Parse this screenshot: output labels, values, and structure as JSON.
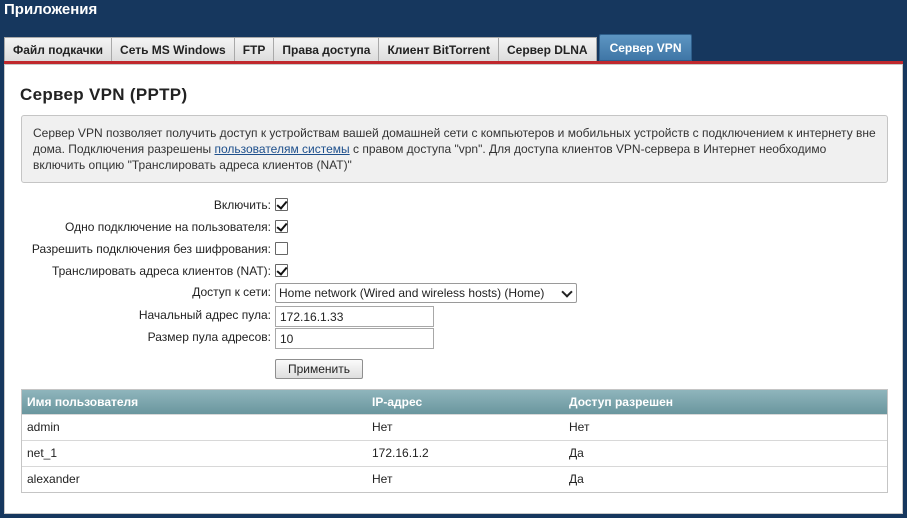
{
  "app": {
    "title": "Приложения"
  },
  "tabs": [
    {
      "label": "Файл подкачки",
      "active": false
    },
    {
      "label": "Сеть MS Windows",
      "active": false
    },
    {
      "label": "FTP",
      "active": false
    },
    {
      "label": "Права доступа",
      "active": false
    },
    {
      "label": "Клиент BitTorrent",
      "active": false
    },
    {
      "label": "Сервер DLNA",
      "active": false
    },
    {
      "label": "Сервер VPN",
      "active": true
    }
  ],
  "page": {
    "title": "Сервер VPN (PPTP)"
  },
  "info": {
    "text_before": "Сервер VPN позволяет получить доступ к устройствам вашей домашней сети с компьютеров и мобильных устройств с подключением к интернету вне дома. Подключения разрешены ",
    "link": "пользователям системы",
    "text_after": " с правом доступа \"vpn\". Для доступа клиентов VPN-сервера в Интернет необходимо включить опцию \"Транслировать адреса клиентов (NAT)\""
  },
  "form": {
    "enable_label": "Включить:",
    "enable_checked": true,
    "single_conn_label": "Одно подключение на пользователя:",
    "single_conn_checked": true,
    "no_encryption_label": "Разрешить подключения без шифрования:",
    "no_encryption_checked": false,
    "nat_label": "Транслировать адреса клиентов (NAT):",
    "nat_checked": true,
    "network_label": "Доступ к сети:",
    "network_value": "Home network (Wired and wireless hosts) (Home)",
    "pool_start_label": "Начальный адрес пула:",
    "pool_start_value": "172.16.1.33",
    "pool_size_label": "Размер пула адресов:",
    "pool_size_value": "10",
    "apply_label": "Применить"
  },
  "users_table": {
    "headers": [
      "Имя пользователя",
      "IP-адрес",
      "Доступ разрешен"
    ],
    "rows": [
      [
        "admin",
        "Нет",
        "Нет"
      ],
      [
        "net_1",
        "172.16.1.2",
        "Да"
      ],
      [
        "alexander",
        "Нет",
        "Да"
      ]
    ]
  },
  "colors": {
    "header_bg": "#16375e",
    "active_tab": "#4a82b0",
    "accent_line": "#c0282d",
    "table_header": "#7ba6ad"
  }
}
